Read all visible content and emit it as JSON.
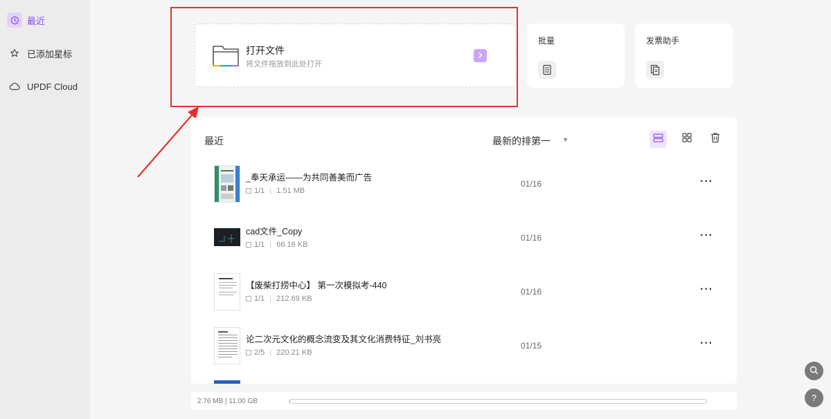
{
  "sidebar": {
    "items": [
      {
        "label": "最近",
        "icon": "clock-icon"
      },
      {
        "label": "已添加星标",
        "icon": "star-icon"
      },
      {
        "label": "UPDF Cloud",
        "icon": "cloud-icon"
      }
    ]
  },
  "open_file": {
    "title": "打开文件",
    "subtitle": "将文件拖放到此处打开"
  },
  "tools": [
    {
      "label": "批量",
      "icon": "batch-icon"
    },
    {
      "label": "发票助手",
      "icon": "invoice-icon"
    }
  ],
  "recent": {
    "title": "最近",
    "sort_label": "最新的排第一",
    "files": [
      {
        "name": "_奉天承运——为共同善美而广告",
        "pages": "1/1",
        "size": "1.51 MB",
        "date": "01/16"
      },
      {
        "name": "cad文件_Copy",
        "pages": "1/1",
        "size": "66.16 KB",
        "date": "01/16"
      },
      {
        "name": "【废柴打捞中心】 第一次模拟考-440",
        "pages": "1/1",
        "size": "212.69 KB",
        "date": "01/16"
      },
      {
        "name": "论二次元文化的概念流变及其文化消费特征_刘书亮",
        "pages": "2/5",
        "size": "220.21 KB",
        "date": "01/15"
      }
    ]
  },
  "storage": {
    "text": "2.76 MB | 11.00 GB",
    "used_fraction": 0.0003
  },
  "colors": {
    "accent": "#8a4fe8",
    "highlight": "#e5312b"
  }
}
